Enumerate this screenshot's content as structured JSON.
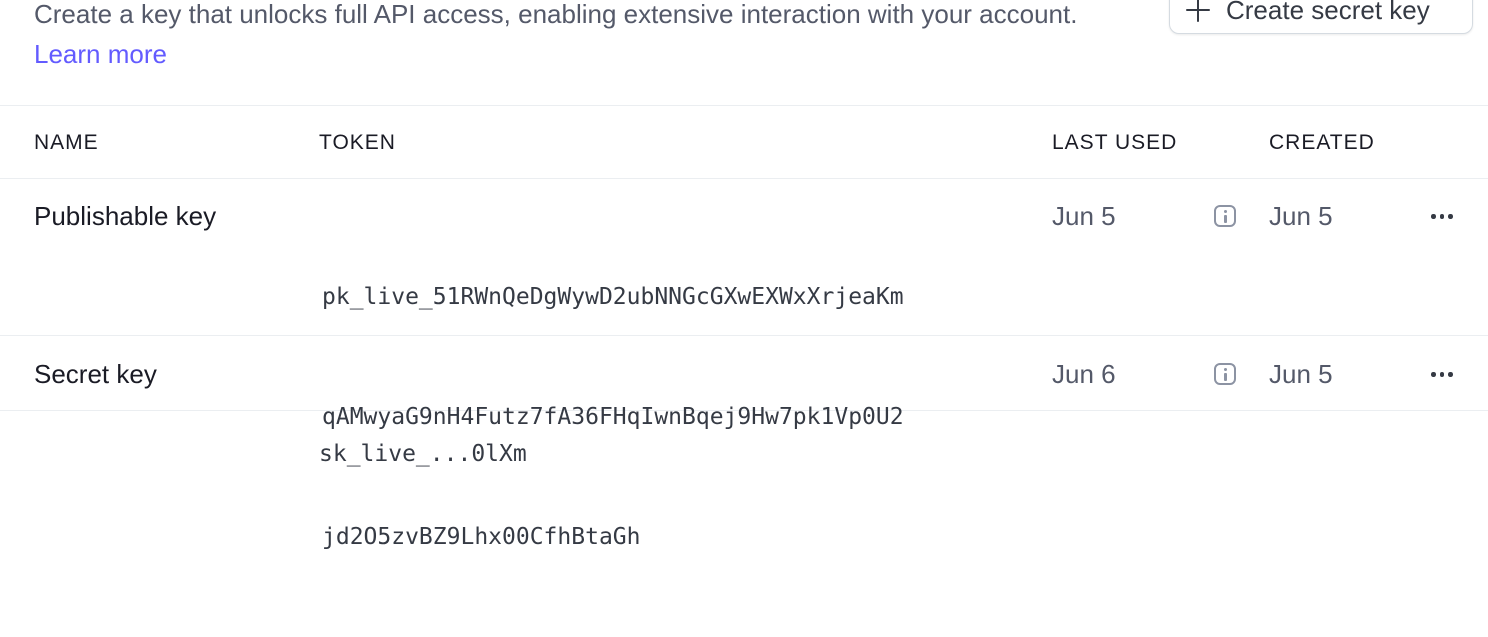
{
  "description": {
    "text": "Create a key that unlocks full API access, enabling extensive interaction with your account.",
    "link": "Learn more"
  },
  "create_button": {
    "label": "Create secret key",
    "icon": "plus-icon"
  },
  "table": {
    "columns": [
      "NAME",
      "TOKEN",
      "LAST USED",
      "CREATED"
    ],
    "rows": [
      {
        "name": "Publishable key",
        "token_lines": [
          "pk_live_51RWnQeDgWywD2ubNNGcGXwEXWxXrjeaKm",
          "qAMwyaG9nH4Futz7fA36FHqIwnBqej9Hw7pk1Vp0U2",
          "jd2O5zvBZ9Lhx00CfhBtaGh"
        ],
        "last_used": "Jun 5",
        "created": "Jun 5"
      },
      {
        "name": "Secret key",
        "token_lines": [
          "sk_live_...0lXm"
        ],
        "last_used": "Jun 6",
        "created": "Jun 5"
      }
    ]
  },
  "colors": {
    "accent": "#635bff",
    "text": "#1a1b25",
    "muted": "#545969",
    "border": "#ebeef1"
  }
}
